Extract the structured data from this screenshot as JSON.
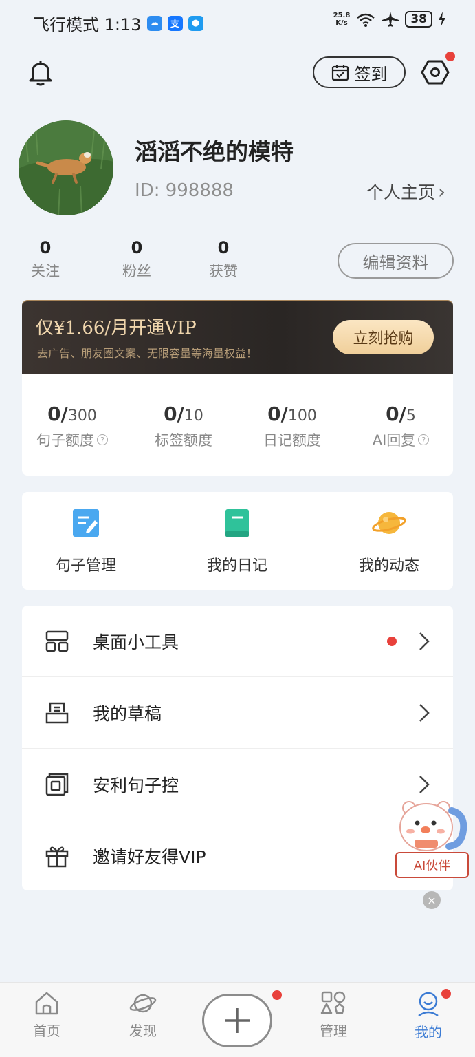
{
  "status_bar": {
    "mode_time": "飞行模式 1:13",
    "app_icons": [
      "weather-icon",
      "alipay-icon",
      "message-icon"
    ],
    "speed_top": "25.8",
    "speed_bottom": "K/s",
    "battery": "38"
  },
  "header": {
    "checkin_label": "签到"
  },
  "profile": {
    "username": "滔滔不绝的模特",
    "id_text": "ID: 998888",
    "homepage_label": "个人主页",
    "homepage_arrow": "›"
  },
  "stats": [
    {
      "value": "0",
      "label": "关注"
    },
    {
      "value": "0",
      "label": "粉丝"
    },
    {
      "value": "0",
      "label": "获赞"
    }
  ],
  "edit_profile_label": "编辑资料",
  "vip": {
    "title": "仅¥1.66/月开通VIP",
    "subtitle": "去广告、朋友圈文案、无限容量等海量权益！",
    "buy_label": "立刻抢购"
  },
  "quotas": [
    {
      "used": "0/",
      "total": "300",
      "label": "句子额度",
      "help": true
    },
    {
      "used": "0/",
      "total": "10",
      "label": "标签额度",
      "help": false
    },
    {
      "used": "0/",
      "total": "100",
      "label": "日记额度",
      "help": false
    },
    {
      "used": "0/",
      "total": "5",
      "label": "AI回复",
      "help": true
    }
  ],
  "help_glyph": "?",
  "shortcuts": [
    {
      "label": "句子管理"
    },
    {
      "label": "我的日记"
    },
    {
      "label": "我的动态"
    }
  ],
  "menu": [
    {
      "label": "桌面小工具",
      "badge": true
    },
    {
      "label": "我的草稿",
      "badge": false
    },
    {
      "label": "安利句子控",
      "badge": false
    },
    {
      "label": "邀请好友得VIP",
      "badge": false
    }
  ],
  "ai_partner": {
    "label": "AI伙伴",
    "close_glyph": "×"
  },
  "bottom_nav": [
    {
      "label": "首页",
      "active": false
    },
    {
      "label": "发现",
      "active": false
    },
    {
      "label": "管理",
      "active": false
    },
    {
      "label": "我的",
      "active": true
    }
  ],
  "colors": {
    "accent": "#3b7bd4",
    "badge": "#e8413b",
    "vip_gold": "#f0d6ad",
    "background": "#eff3f8"
  }
}
